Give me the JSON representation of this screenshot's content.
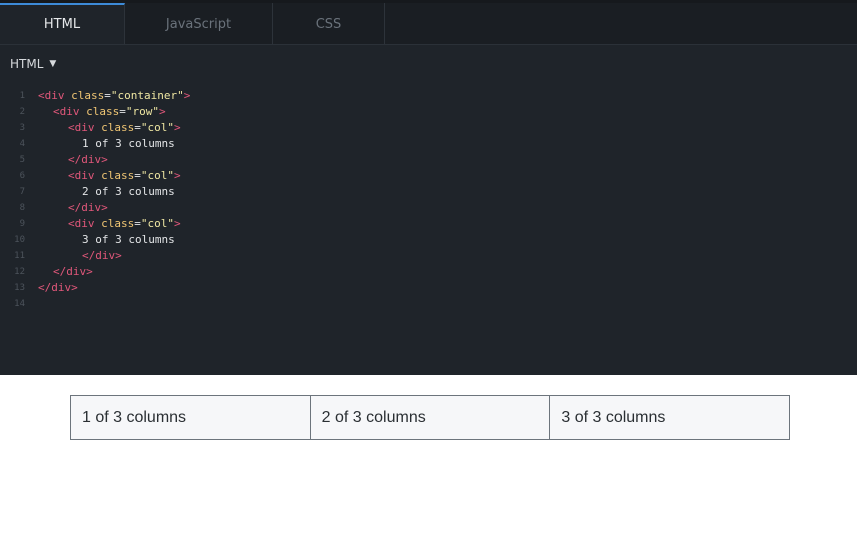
{
  "editor": {
    "tabs": [
      {
        "label": "HTML",
        "active": true
      },
      {
        "label": "JavaScript",
        "active": false
      },
      {
        "label": "CSS",
        "active": false
      }
    ],
    "language_select": "HTML",
    "code_lines": [
      {
        "n": "1",
        "text": "<div class=\"container\">"
      },
      {
        "n": "2",
        "text": "<div class=\"row\">"
      },
      {
        "n": "3",
        "text": "<div class=\"col\">"
      },
      {
        "n": "4",
        "text": "1 of 3 columns"
      },
      {
        "n": "5",
        "text": "</div>"
      },
      {
        "n": "6",
        "text": "<div class=\"col\">"
      },
      {
        "n": "7",
        "text": "2 of 3 columns"
      },
      {
        "n": "8",
        "text": "</div>"
      },
      {
        "n": "9",
        "text": "<div class=\"col\">"
      },
      {
        "n": "10",
        "text": "3 of 3 columns"
      },
      {
        "n": "11",
        "text": "</div>"
      },
      {
        "n": "12",
        "text": "</div>"
      },
      {
        "n": "13",
        "text": "</div>"
      },
      {
        "n": "14",
        "text": ""
      }
    ]
  },
  "preview": {
    "columns": [
      "1 of 3 columns",
      "2 of 3 columns",
      "3 of 3 columns"
    ]
  },
  "colors": {
    "editor_bg": "#1f242a",
    "tag": "#e0577a",
    "attr": "#f0c674",
    "string": "#eee6a2",
    "active_tab_accent": "#3d8bd8"
  }
}
